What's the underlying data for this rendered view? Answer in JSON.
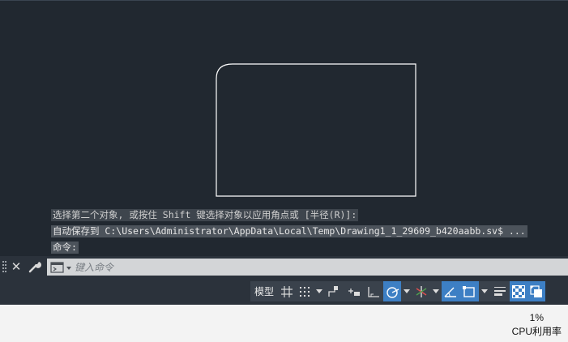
{
  "history": {
    "line1": "选择第二个对象, 或按住 Shift 键选择对象以应用角点或 [半径(R)]:",
    "line2": "自动保存到 C:\\Users\\Administrator\\AppData\\Local\\Temp\\Drawing1_1_29609_b420aabb.sv$ ...",
    "line3": "命令:"
  },
  "command_line": {
    "placeholder": "键入命令",
    "value": ""
  },
  "statusbar": {
    "model_label": "模型",
    "items": [
      "grid",
      "snap",
      "snap-dropdown",
      "ortho",
      "dynamic-input",
      "inference",
      "polar",
      "polar-dropdown",
      "isodraft",
      "isodraft-dropdown",
      "osnap-tracking",
      "osnap",
      "osnap-dropdown",
      "lineweight",
      "transparency",
      "selection-cycling"
    ],
    "active_color": "#3d7fc4"
  },
  "taskbar": {
    "cpu_value": "1%",
    "cpu_label": "CPU利用率"
  },
  "colors": {
    "canvas": "#212830",
    "panel": "#2b323b",
    "geometry": "#ffffff"
  }
}
